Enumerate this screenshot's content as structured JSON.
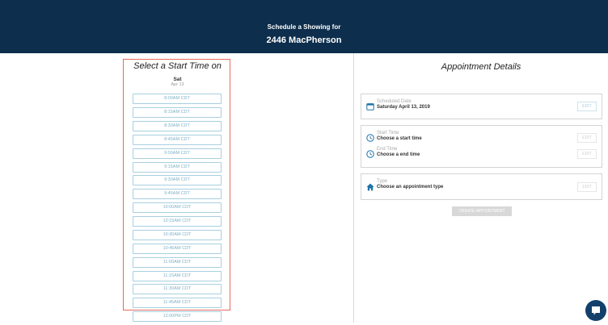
{
  "header": {
    "subtitle": "Schedule a Showing for",
    "address": "2446 MacPherson"
  },
  "left": {
    "title": "Select a Start Time on",
    "day": "Sat",
    "date": "Apr 13",
    "slots": [
      "8:00AM CDT",
      "8:15AM CDT",
      "8:30AM CDT",
      "8:45AM CDT",
      "9:00AM CDT",
      "9:15AM CDT",
      "9:30AM CDT",
      "9:45AM CDT",
      "10:00AM CDT",
      "10:15AM CDT",
      "10:30AM CDT",
      "10:45AM CDT",
      "11:00AM CDT",
      "11:15AM CDT",
      "11:30AM CDT",
      "11:45AM CDT",
      "12:00PM CDT"
    ]
  },
  "right": {
    "title": "Appointment Details",
    "date_card": {
      "label": "Scheduled Date",
      "value": "Saturday April 13, 2019",
      "edit": "EDIT"
    },
    "time_card": {
      "start_label": "Start Time",
      "start_value": "Choose a start time",
      "start_edit": "EDIT",
      "end_label": "End Time",
      "end_value": "Choose a end time",
      "end_edit": "EDIT"
    },
    "type_card": {
      "label": "Type",
      "value": "Choose an appointment type",
      "edit": "EDIT"
    },
    "create_button": "CREATE APPOINTMENT"
  },
  "icons": {
    "date": "calendar-icon",
    "time": "clock-icon",
    "type": "home-icon",
    "chat": "chat-icon"
  },
  "colors": {
    "header": "#0d2e4c",
    "accent": "#1e73a8",
    "highlight": "#e86b5f",
    "chat": "#13406b"
  }
}
